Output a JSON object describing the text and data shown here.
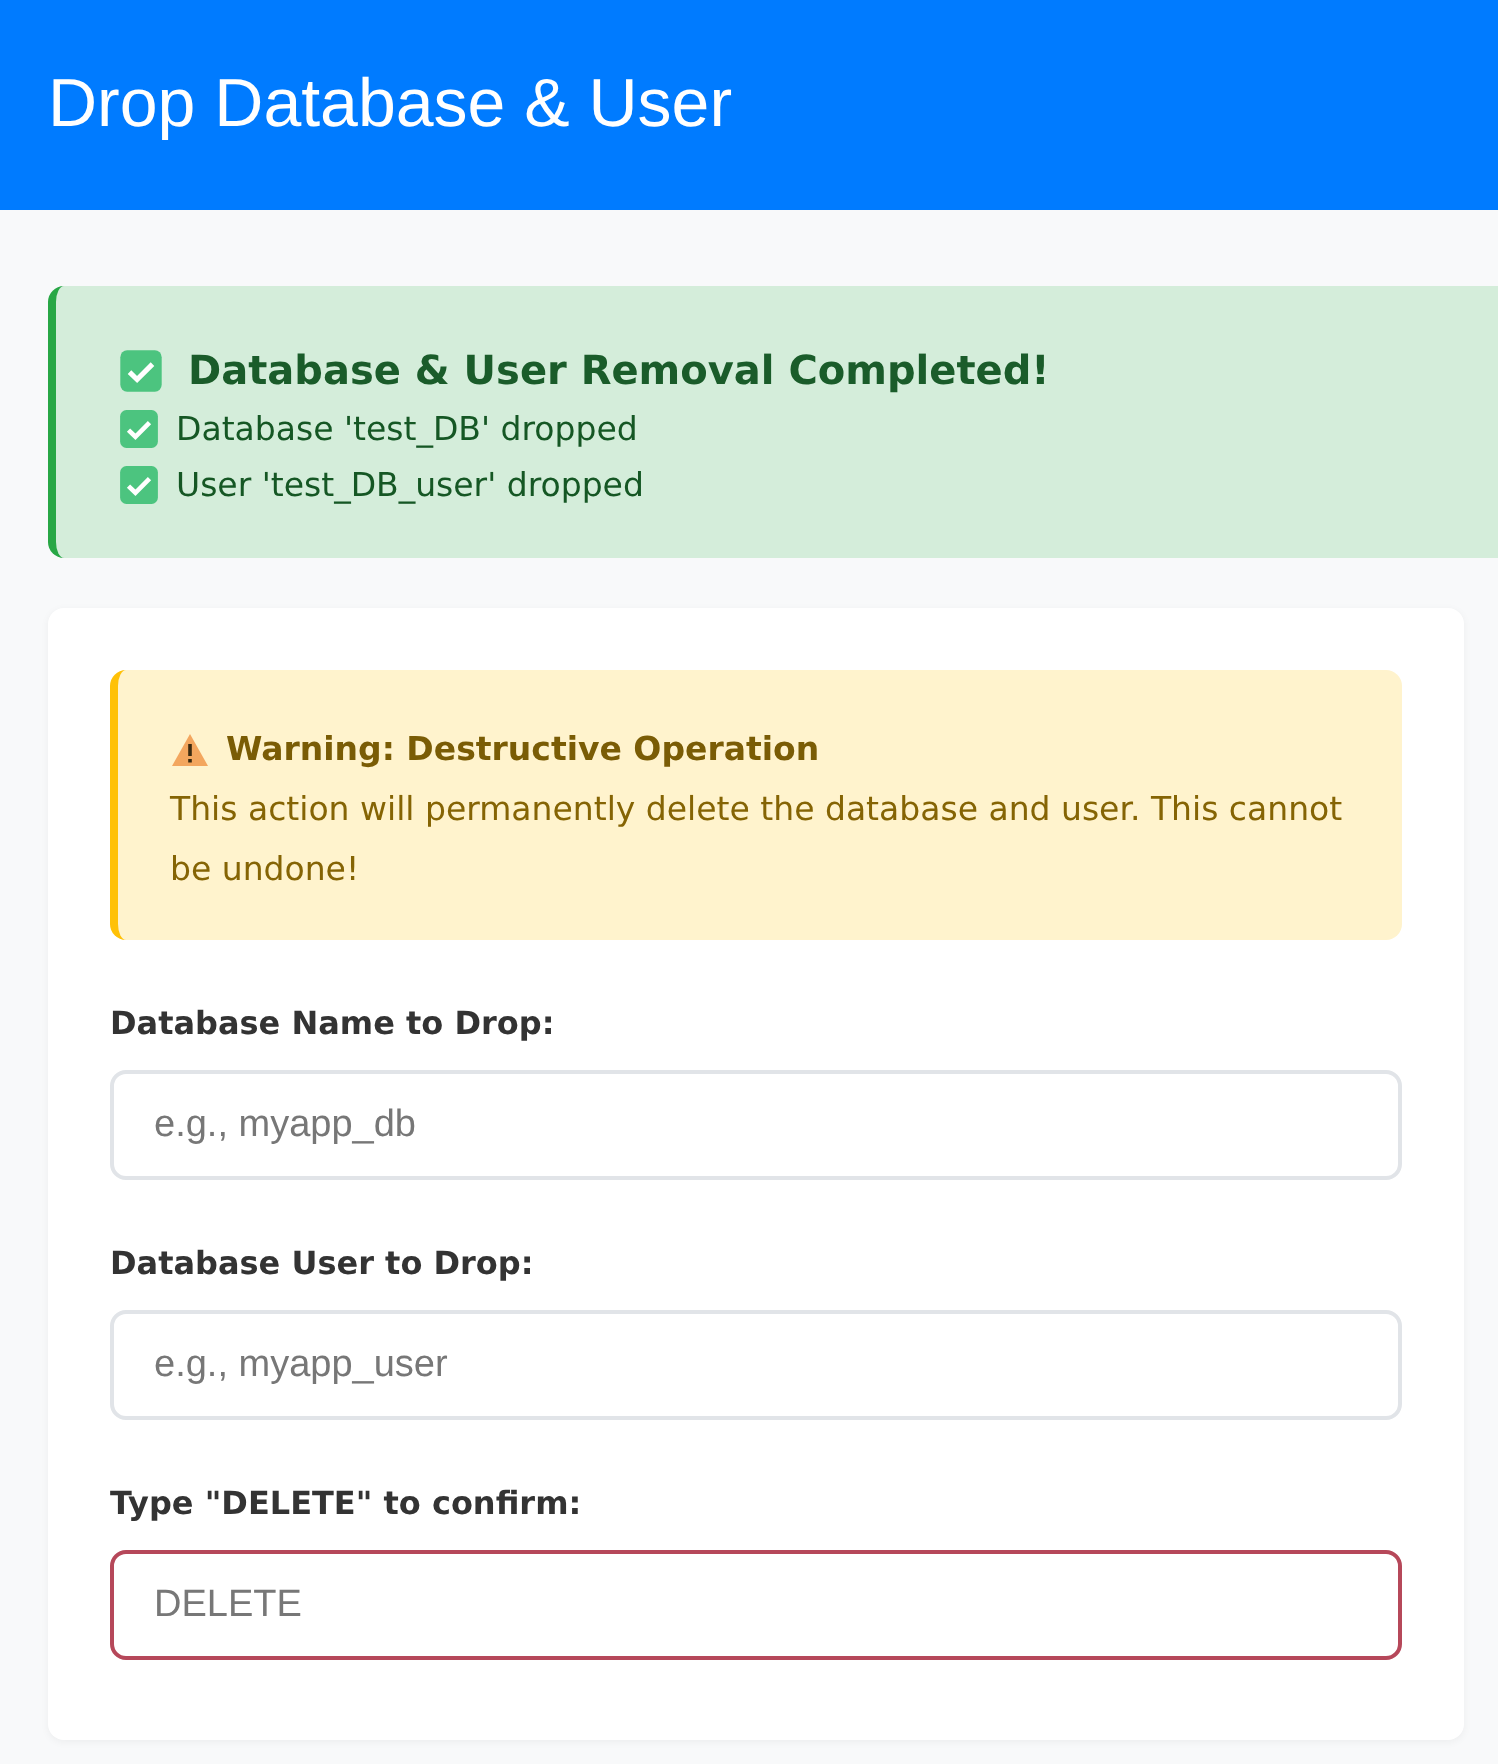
{
  "header": {
    "title": "Drop Database & User"
  },
  "success": {
    "title": "Database & User Removal Completed!",
    "items": [
      "Database 'test_DB' dropped",
      "User 'test_DB_user' dropped"
    ]
  },
  "warning": {
    "title": "Warning: Destructive Operation",
    "text": "This action will permanently delete the database and user. This cannot be undone!"
  },
  "fields": [
    {
      "label": "Database Name to Drop:",
      "placeholder": "e.g., myapp_db",
      "danger": false
    },
    {
      "label": "Database User to Drop:",
      "placeholder": "e.g., myapp_user",
      "danger": false
    },
    {
      "label": "Type \"DELETE\" to confirm:",
      "placeholder": "DELETE",
      "danger": true
    }
  ]
}
